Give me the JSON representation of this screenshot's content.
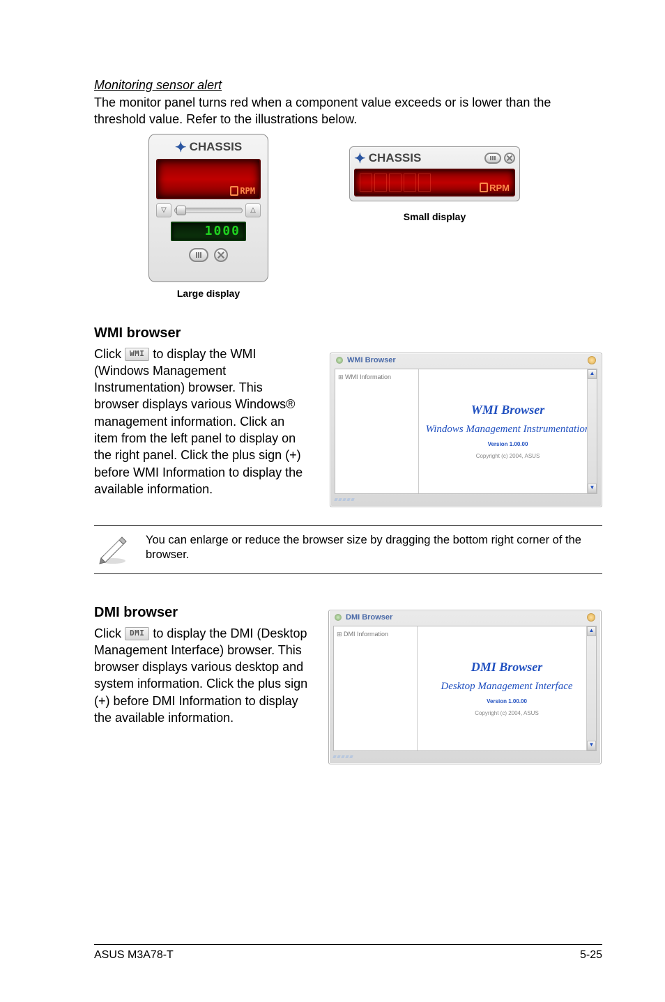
{
  "intro": {
    "heading": "Monitoring sensor alert",
    "body": "The monitor panel turns red when a component value exceeds or is lower than the threshold value. Refer to the illustrations below."
  },
  "panels": {
    "large": {
      "title": "CHASSIS",
      "rpm_unit": "RPM",
      "threshold_display": "1000",
      "caption": "Large display"
    },
    "small": {
      "title": "CHASSIS",
      "rpm_unit": "RPM",
      "caption": "Small display"
    }
  },
  "wmi": {
    "heading": "WMI browser",
    "pre_text": "Click ",
    "btn": "WMI",
    "post_text": " to display the WMI (Windows Management Instrumentation) browser. This browser displays various Windows® management information. Click an item from the left panel to display on the right panel. Click the plus sign (+) before WMI Information to display the available information.",
    "win_title": "WMI Browser",
    "tree_root": "WMI Information",
    "pane_title": "WMI Browser",
    "pane_sub": "Windows Management Instrumentation",
    "version": "Version 1.00.00",
    "copyright": "Copyright (c) 2004, ASUS"
  },
  "note": "You can enlarge or reduce the browser size by dragging the bottom right corner of the browser.",
  "dmi": {
    "heading": "DMI browser",
    "pre_text": "Click ",
    "btn": "DMI",
    "post_text": " to display the DMI (Desktop Management Interface) browser. This browser displays various desktop and system information. Click the plus sign (+) before DMI Information to display the available information.",
    "win_title": "DMI Browser",
    "tree_root": "DMI Information",
    "pane_title": "DMI Browser",
    "pane_sub": "Desktop Management Interface",
    "version": "Version 1.00.00",
    "copyright": "Copyright (c) 2004, ASUS"
  },
  "footer": {
    "left": "ASUS M3A78-T",
    "right": "5-25"
  }
}
